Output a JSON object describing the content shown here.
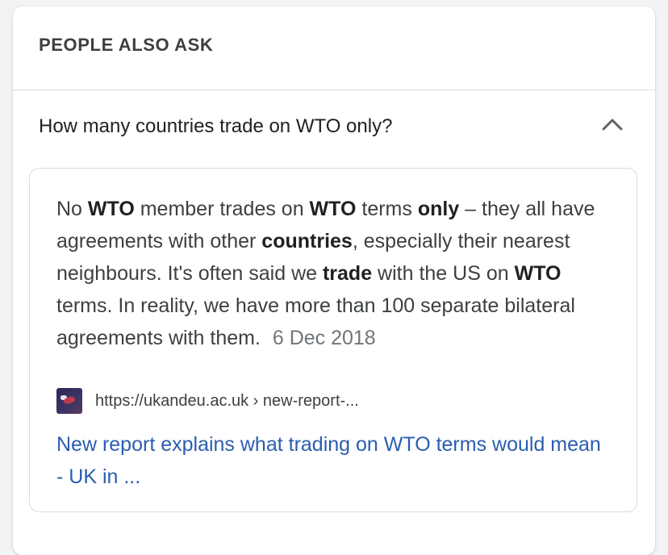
{
  "header": {
    "title": "PEOPLE ALSO ASK"
  },
  "question": {
    "text": "How many countries trade on WTO only?",
    "expanded": true,
    "chevron_icon": "chevron-up-icon"
  },
  "answer": {
    "segments": [
      {
        "text": "No ",
        "bold": false
      },
      {
        "text": "WTO",
        "bold": true
      },
      {
        "text": " member trades on ",
        "bold": false
      },
      {
        "text": "WTO",
        "bold": true
      },
      {
        "text": " terms ",
        "bold": false
      },
      {
        "text": "only",
        "bold": true
      },
      {
        "text": " – they all have agreements with other ",
        "bold": false
      },
      {
        "text": "countries",
        "bold": true
      },
      {
        "text": ", especially their nearest neighbours. It's often said we ",
        "bold": false
      },
      {
        "text": "trade",
        "bold": true
      },
      {
        "text": " with the US on ",
        "bold": false
      },
      {
        "text": "WTO",
        "bold": true
      },
      {
        "text": " terms. In reality, we have more than 100 separate bilateral agreements with them. ",
        "bold": false
      }
    ],
    "date": "6 Dec 2018",
    "source": {
      "favicon_icon": "site-favicon-icon",
      "url": "https://ukandeu.ac.uk › new-report-...",
      "link_title": "New report explains what trading on WTO terms would mean - UK in ...",
      "link_color": "#2a5db0"
    }
  }
}
